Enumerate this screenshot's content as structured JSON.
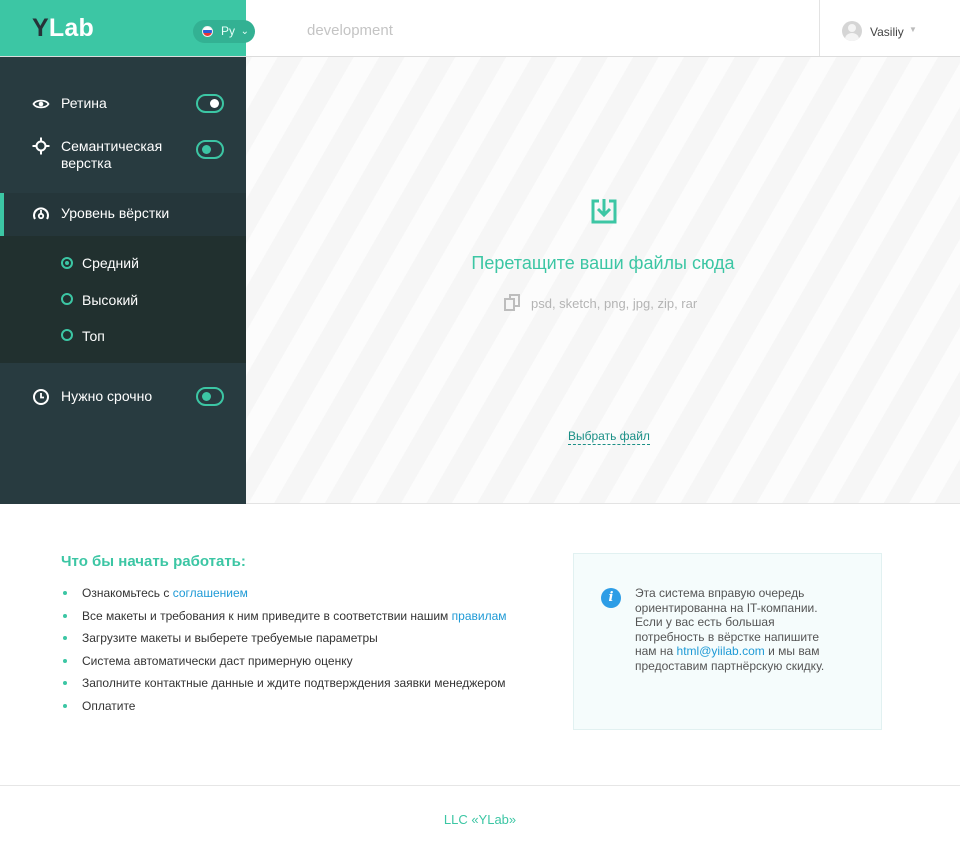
{
  "header": {
    "logo_y": "Y",
    "logo_rest": "Lab",
    "language": "Ру",
    "environment": "development",
    "user_name": "Vasiliy"
  },
  "sidebar": {
    "retina_label": "Ретина",
    "retina_on": true,
    "semantic_label_1": "Семантическая",
    "semantic_label_2": "верстка",
    "semantic_on": false,
    "level_label": "Уровень вёрстки",
    "levels": [
      {
        "label": "Средний",
        "selected": true
      },
      {
        "label": "Высокий",
        "selected": false
      },
      {
        "label": "Топ",
        "selected": false
      }
    ],
    "urgent_label": "Нужно срочно",
    "urgent_on": false
  },
  "dropzone": {
    "title": "Перетащите ваши файлы сюда",
    "formats": "psd, sketch, png, jpg, zip, rar",
    "choose_file": "Выбрать файл"
  },
  "steps": {
    "title": "Что бы начать работать:",
    "items": [
      {
        "text": "Ознакомьтесь с ",
        "link": "соглашением"
      },
      {
        "text": "Все макеты и требования к ним приведите в соответствии нашим ",
        "link": "правилам"
      },
      {
        "text": "Загрузите макеты и выберете требуемые параметры",
        "link": ""
      },
      {
        "text": "Система автоматически даст примерную оценку",
        "link": ""
      },
      {
        "text": "Заполните контактные данные и ждите подтверждения заявки менеджером",
        "link": ""
      },
      {
        "text": "Оплатите",
        "link": ""
      }
    ]
  },
  "info": {
    "text_before": "Эта система вправую очередь ориентированна на IT-компании. Если у вас есть большая потребность в вёрстке напишите нам на ",
    "email": "html@yiilab.com",
    "text_after": " и мы вам предоставим партнёрскую скидку."
  },
  "footer": {
    "text": "LLC «YLab»"
  },
  "colors": {
    "accent": "#3cc6a4",
    "sidebar_bg": "#283b40",
    "link": "#1e9ad6"
  }
}
